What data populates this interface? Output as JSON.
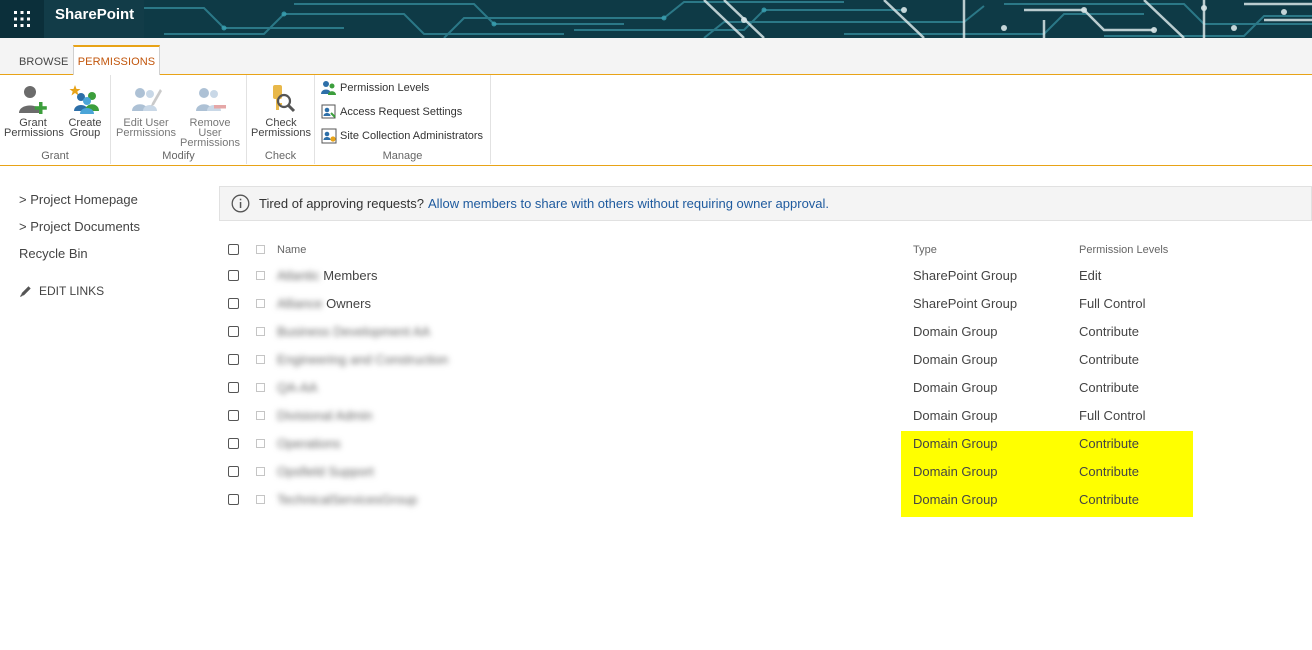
{
  "suite_bar": {
    "app_name": "SharePoint",
    "waffle_icon": "waffle-icon"
  },
  "ribbon": {
    "tabs": [
      {
        "label": "BROWSE",
        "active": false
      },
      {
        "label": "PERMISSIONS",
        "active": true
      }
    ],
    "groups": {
      "grant": {
        "label": "Grant",
        "buttons": [
          {
            "line1": "Grant",
            "line2": "Permissions",
            "icon": "grant-permissions-icon"
          },
          {
            "line1": "Create",
            "line2": "Group",
            "icon": "create-group-icon"
          }
        ]
      },
      "modify": {
        "label": "Modify",
        "buttons": [
          {
            "line1": "Edit User",
            "line2": "Permissions",
            "icon": "edit-user-permissions-icon"
          },
          {
            "line1": "Remove User",
            "line2": "Permissions",
            "icon": "remove-user-permissions-icon"
          }
        ]
      },
      "check": {
        "label": "Check",
        "buttons": [
          {
            "line1": "Check",
            "line2": "Permissions",
            "icon": "check-permissions-icon"
          }
        ]
      },
      "manage": {
        "label": "Manage",
        "items": [
          {
            "label": "Permission Levels",
            "icon": "permission-levels-icon"
          },
          {
            "label": "Access Request Settings",
            "icon": "access-request-settings-icon"
          },
          {
            "label": "Site Collection Administrators",
            "icon": "site-collection-admins-icon"
          }
        ]
      }
    }
  },
  "left_nav": {
    "items": [
      "> Project Homepage",
      "> Project Documents",
      "Recycle Bin"
    ],
    "edit_links": "EDIT LINKS"
  },
  "info_bar": {
    "text": "Tired of approving requests?",
    "link": "Allow members to share with others without requiring owner approval."
  },
  "table": {
    "columns": {
      "name": "Name",
      "type": "Type",
      "permission_levels": "Permission Levels"
    },
    "rows": [
      {
        "name_blurred": "Atlantic",
        "name_visible": "Members",
        "type": "SharePoint Group",
        "permission": "Edit"
      },
      {
        "name_blurred": "Alliance",
        "name_visible": "Owners",
        "type": "SharePoint Group",
        "permission": "Full Control"
      },
      {
        "name_blurred": "Business Development AA",
        "name_visible": "",
        "type": "Domain Group",
        "permission": "Contribute"
      },
      {
        "name_blurred": "Engineering and Construction",
        "name_visible": "",
        "type": "Domain Group",
        "permission": "Contribute"
      },
      {
        "name_blurred": "QA-AA",
        "name_visible": "",
        "type": "Domain Group",
        "permission": "Contribute"
      },
      {
        "name_blurred": "Divisional Admin",
        "name_visible": "",
        "type": "Domain Group",
        "permission": "Full Control"
      },
      {
        "name_blurred": "Operations",
        "name_visible": "",
        "type": "Domain Group",
        "permission": "Contribute"
      },
      {
        "name_blurred": "Opsfield Support",
        "name_visible": "",
        "type": "Domain Group",
        "permission": "Contribute"
      },
      {
        "name_blurred": "TechnicalServicesGroup",
        "name_visible": "",
        "type": "Domain Group",
        "permission": "Contribute"
      }
    ]
  },
  "colors": {
    "accent": "#e8a317",
    "active_tab_text": "#c2560c",
    "link": "#1e5a9e",
    "highlight": "#ffff00"
  }
}
